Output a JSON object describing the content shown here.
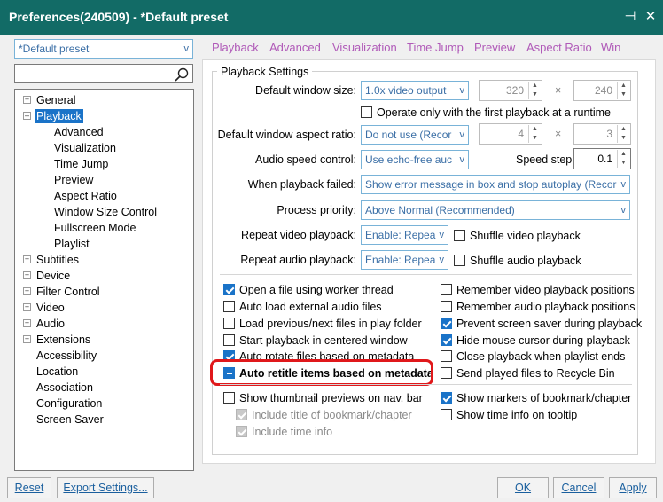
{
  "window": {
    "title": "Preferences(240509) - *Default preset",
    "pin_glyph": "⊣",
    "close_glyph": "✕"
  },
  "preset": {
    "value": "*Default preset",
    "arrow": "v"
  },
  "search": {
    "value": "",
    "icon": "search-icon"
  },
  "tabs": [
    "Playback",
    "Advanced",
    "Visualization",
    "Time Jump",
    "Preview",
    "Aspect Ratio",
    "Win"
  ],
  "tree": [
    {
      "label": "General",
      "level": 0,
      "expander": "+"
    },
    {
      "label": "Playback",
      "level": 0,
      "expander": "-",
      "selected": true
    },
    {
      "label": "Advanced",
      "level": 1
    },
    {
      "label": "Visualization",
      "level": 1
    },
    {
      "label": "Time Jump",
      "level": 1
    },
    {
      "label": "Preview",
      "level": 1
    },
    {
      "label": "Aspect Ratio",
      "level": 1
    },
    {
      "label": "Window Size Control",
      "level": 1
    },
    {
      "label": "Fullscreen Mode",
      "level": 1
    },
    {
      "label": "Playlist",
      "level": 1
    },
    {
      "label": "Subtitles",
      "level": 0,
      "expander": "+"
    },
    {
      "label": "Device",
      "level": 0,
      "expander": "+"
    },
    {
      "label": "Filter Control",
      "level": 0,
      "expander": "+"
    },
    {
      "label": "Video",
      "level": 0,
      "expander": "+"
    },
    {
      "label": "Audio",
      "level": 0,
      "expander": "+"
    },
    {
      "label": "Extensions",
      "level": 0,
      "expander": "+"
    },
    {
      "label": "Accessibility",
      "level": 0
    },
    {
      "label": "Location",
      "level": 0
    },
    {
      "label": "Association",
      "level": 0
    },
    {
      "label": "Configuration",
      "level": 0
    },
    {
      "label": "Screen Saver",
      "level": 0
    }
  ],
  "group": {
    "title": "Playback Settings"
  },
  "settings": {
    "window_size_label": "Default window size:",
    "window_size_value": "1.0x video output",
    "window_w": "320",
    "window_h": "240",
    "times": "×",
    "first_only_label": "Operate only with the first playback at a runtime",
    "aspect_label": "Default window aspect ratio:",
    "aspect_value": "Do not use (Recor",
    "aspect_w": "4",
    "aspect_h": "3",
    "audio_speed_label": "Audio speed control:",
    "audio_speed_value": "Use echo-free auc",
    "speed_step_label": "Speed step:",
    "speed_step_value": "0.1",
    "failed_label": "When playback failed:",
    "failed_value": "Show error message in box and stop autoplay (Recor",
    "priority_label": "Process priority:",
    "priority_value": "Above Normal (Recommended)",
    "repeat_video_label": "Repeat video playback:",
    "repeat_video_value": "Enable: Repea",
    "shuffle_video_label": "Shuffle video playback",
    "repeat_audio_label": "Repeat audio playback:",
    "repeat_audio_value": "Enable: Repea",
    "shuffle_audio_label": "Shuffle audio playback"
  },
  "checks_left": [
    {
      "label": "Open a file using worker thread",
      "state": "checked"
    },
    {
      "label": "Auto load external audio files",
      "state": "unchecked"
    },
    {
      "label": "Load previous/next files in play folder",
      "state": "unchecked"
    },
    {
      "label": "Start playback in centered window",
      "state": "unchecked"
    },
    {
      "label": "Auto rotate files based on metadata",
      "state": "checked"
    },
    {
      "label": "Auto retitle items based on metadata",
      "state": "partial"
    }
  ],
  "checks_right": [
    {
      "label": "Remember video playback positions",
      "state": "unchecked"
    },
    {
      "label": "Remember audio playback positions",
      "state": "unchecked"
    },
    {
      "label": "Prevent screen saver during playback",
      "state": "checked"
    },
    {
      "label": "Hide mouse cursor during playback",
      "state": "checked"
    },
    {
      "label": "Close playback when playlist ends",
      "state": "unchecked"
    },
    {
      "label": "Send played files to Recycle Bin",
      "state": "unchecked"
    }
  ],
  "thumb": {
    "label": "Show thumbnail previews on nav. bar",
    "sub1": "Include title of bookmark/chapter",
    "sub2": "Include time info"
  },
  "markers": {
    "label": "Show markers of bookmark/chapter",
    "time": "Show time info on tooltip"
  },
  "buttons": {
    "reset": "Reset",
    "export": "Export Settings...",
    "ok": "OK",
    "cancel": "Cancel",
    "apply": "Apply"
  },
  "colors": {
    "titlebar": "#126b66",
    "highlight": "#e0181b",
    "selected": "#1a73c8"
  }
}
